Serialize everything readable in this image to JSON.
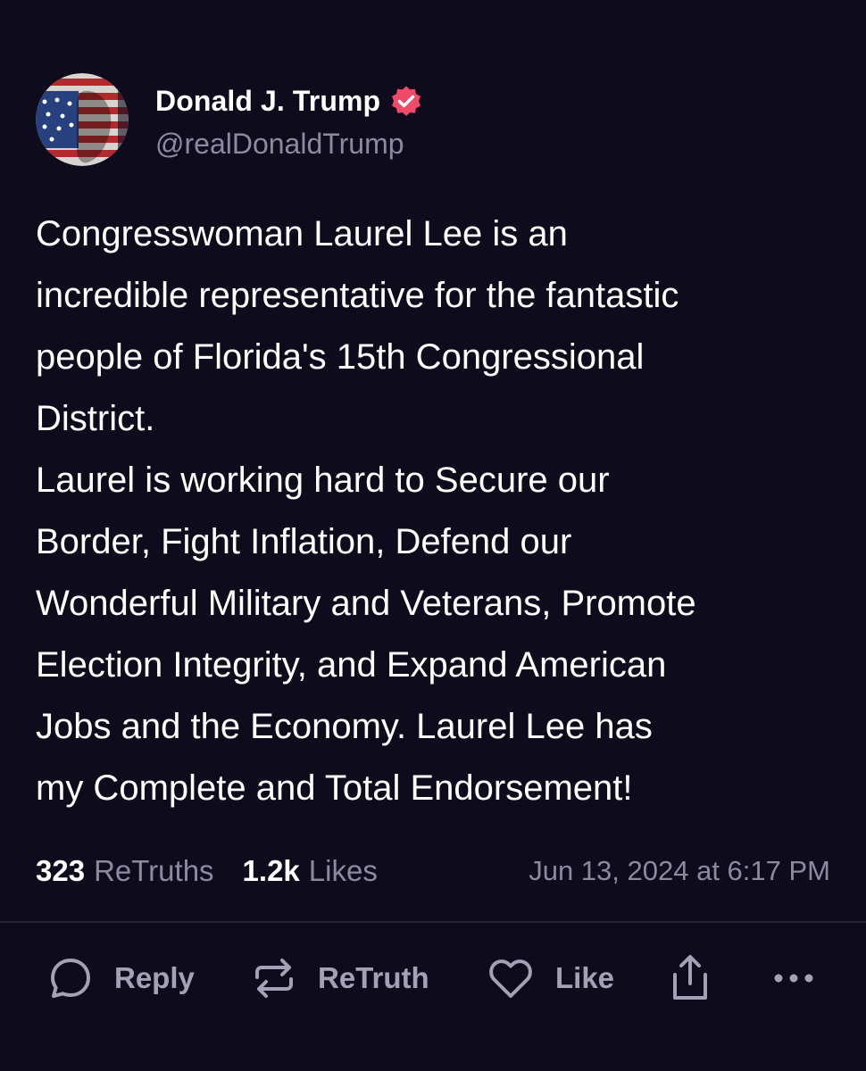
{
  "post": {
    "author": {
      "display_name": "Donald J. Trump",
      "handle": "@realDonaldTrump",
      "verified_icon": "verified-badge-icon",
      "badge_color": "#ef4a6a"
    },
    "content": "Congresswoman Laurel Lee is an\nincredible representative for the fantastic\npeople of Florida's 15th Congressional\nDistrict.\nLaurel is working hard to Secure our\nBorder, Fight Inflation, Defend our\nWonderful Military and Veterans, Promote\nElection Integrity, and Expand American\nJobs and the Economy.   Laurel Lee has\nmy Complete and Total Endorsement!",
    "stats": {
      "retruths_count": "323",
      "retruths_label": "ReTruths",
      "likes_count": "1.2k",
      "likes_label": "Likes",
      "timestamp": "Jun 13, 2024 at 6:17 PM"
    },
    "actions": {
      "reply_label": "Reply",
      "retruth_label": "ReTruth",
      "like_label": "Like"
    }
  },
  "colors": {
    "background": "#0d0b1c",
    "muted_text": "#8c8aa0",
    "action_text": "#a3a1b5"
  }
}
